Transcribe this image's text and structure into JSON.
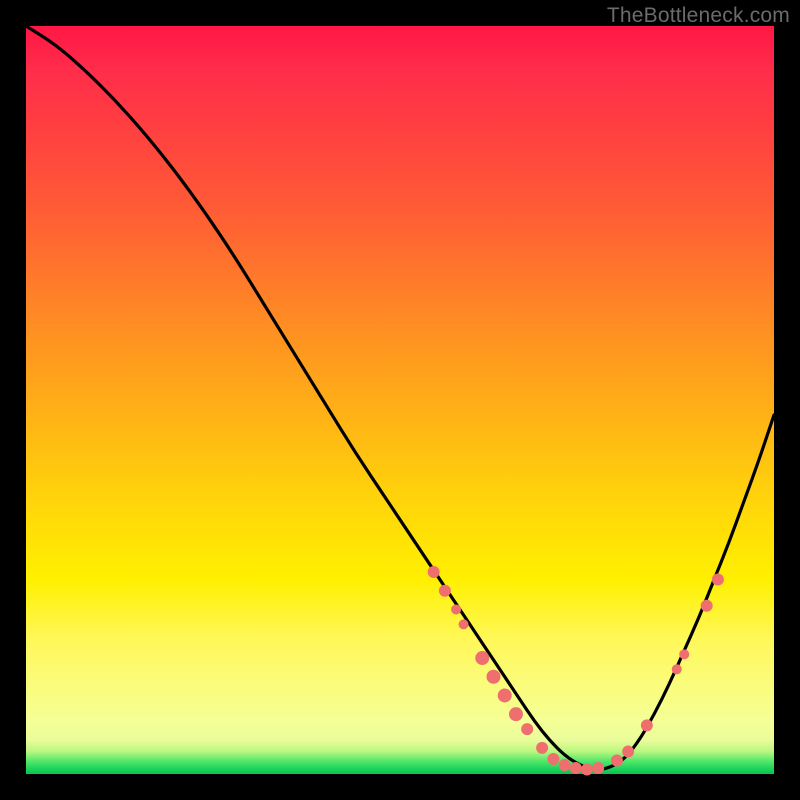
{
  "watermark": "TheBottleneck.com",
  "colors": {
    "page_bg": "#000000",
    "curve_stroke": "#000000",
    "marker_fill": "#ef6f6f",
    "marker_stroke": "#e85c5c"
  },
  "chart_data": {
    "type": "line",
    "title": "",
    "xlabel": "",
    "ylabel": "",
    "xlim": [
      0,
      100
    ],
    "ylim": [
      0,
      100
    ],
    "series": [
      {
        "name": "bottleneck-curve",
        "x": [
          0,
          4,
          8,
          12,
          16,
          20,
          24,
          28,
          32,
          36,
          40,
          44,
          48,
          52,
          56,
          58,
          60,
          62,
          64,
          66,
          68,
          70,
          72,
          74,
          76,
          78,
          80,
          82,
          84,
          86,
          88,
          90,
          92,
          94,
          96,
          98,
          100
        ],
        "y": [
          100,
          97.5,
          94,
          90,
          85.5,
          80.5,
          75,
          69,
          62.5,
          56,
          49.5,
          43,
          37,
          31,
          25,
          22,
          19,
          16,
          13,
          10,
          7,
          4.5,
          2.5,
          1.2,
          0.5,
          0.8,
          2,
          4.5,
          8,
          12,
          16.5,
          21,
          26,
          31,
          36.5,
          42,
          48
        ]
      }
    ],
    "markers": [
      {
        "x": 54.5,
        "y": 27,
        "r": 6
      },
      {
        "x": 56,
        "y": 24.5,
        "r": 6
      },
      {
        "x": 57.5,
        "y": 22,
        "r": 5
      },
      {
        "x": 58.5,
        "y": 20,
        "r": 5
      },
      {
        "x": 61,
        "y": 15.5,
        "r": 7
      },
      {
        "x": 62.5,
        "y": 13,
        "r": 7
      },
      {
        "x": 64,
        "y": 10.5,
        "r": 7
      },
      {
        "x": 65.5,
        "y": 8,
        "r": 7
      },
      {
        "x": 67,
        "y": 6,
        "r": 6
      },
      {
        "x": 69,
        "y": 3.5,
        "r": 6
      },
      {
        "x": 70.5,
        "y": 2,
        "r": 6
      },
      {
        "x": 72,
        "y": 1.2,
        "r": 6
      },
      {
        "x": 73.5,
        "y": 0.8,
        "r": 6
      },
      {
        "x": 75,
        "y": 0.6,
        "r": 6
      },
      {
        "x": 76.5,
        "y": 0.8,
        "r": 6
      },
      {
        "x": 79,
        "y": 1.8,
        "r": 6
      },
      {
        "x": 80.5,
        "y": 3,
        "r": 6
      },
      {
        "x": 83,
        "y": 6.5,
        "r": 6
      },
      {
        "x": 87,
        "y": 14,
        "r": 5
      },
      {
        "x": 88,
        "y": 16,
        "r": 5
      },
      {
        "x": 91,
        "y": 22.5,
        "r": 6
      },
      {
        "x": 92.5,
        "y": 26,
        "r": 6
      }
    ]
  }
}
